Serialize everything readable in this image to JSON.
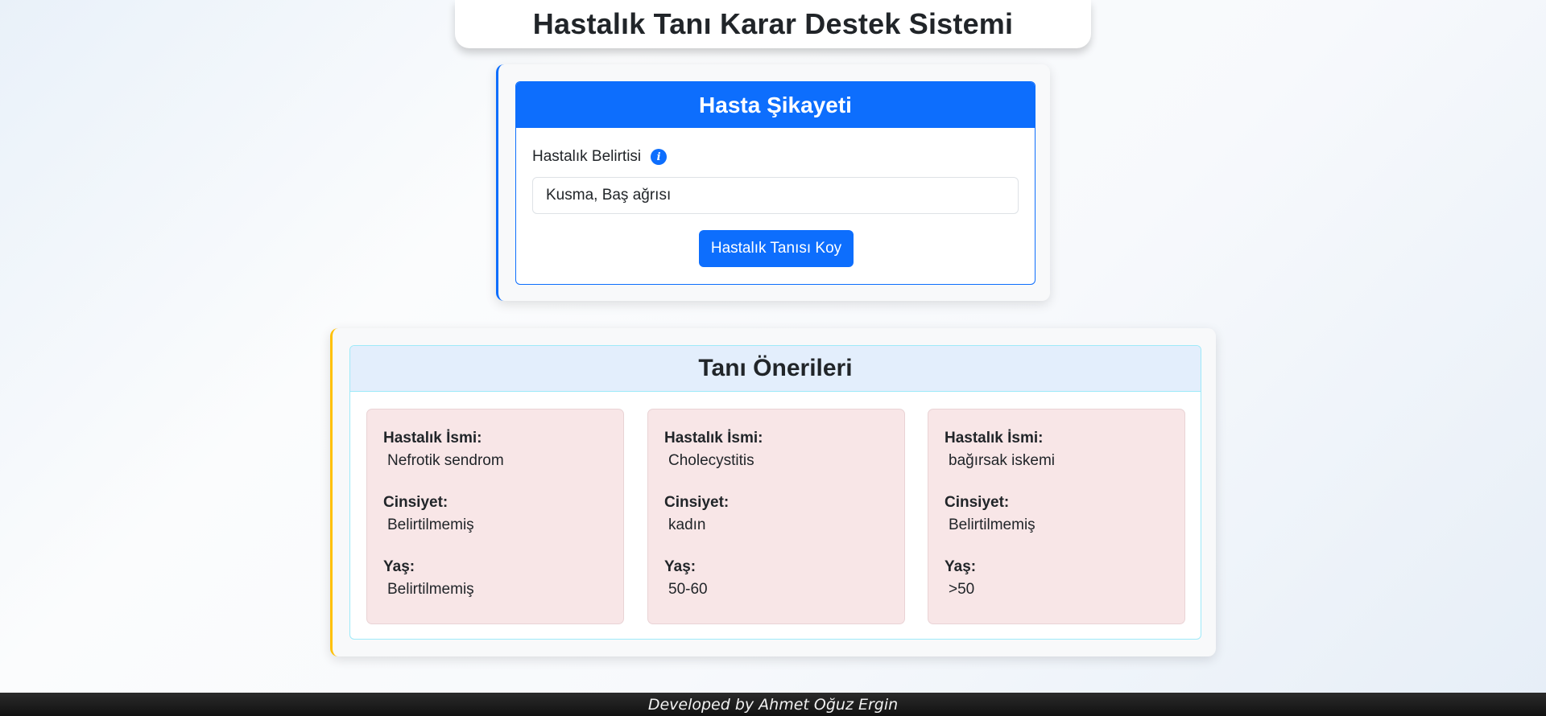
{
  "header": {
    "title": "Hastalık Tanı Karar Destek Sistemi"
  },
  "complaint": {
    "title": "Hasta Şikayeti",
    "field_label": "Hastalık Belirtisi",
    "info_icon": "info-icon",
    "input_value": "Kusma, Baş ağrısı",
    "submit_label": "Hastalık Tanısı Koy"
  },
  "results": {
    "title": "Tanı Önerileri",
    "labels": {
      "disease": "Hastalık İsmi:",
      "gender": "Cinsiyet:",
      "age": "Yaş:"
    },
    "items": [
      {
        "disease": "Nefrotik sendrom",
        "gender": "Belirtilmemiş",
        "age": "Belirtilmemiş"
      },
      {
        "disease": "Cholecystitis",
        "gender": "kadın",
        "age": "50-60"
      },
      {
        "disease": "bağırsak iskemi",
        "gender": "Belirtilmemiş",
        "age": ">50"
      }
    ]
  },
  "footer": {
    "text": "Developed by Ahmet Oğuz Ergin"
  },
  "colors": {
    "primary": "#0d6efd",
    "warning_accent": "#ffc107",
    "result_card_bg": "#f8e6e7",
    "results_header_bg": "#e3eefc",
    "footer_bg": "#111111"
  }
}
